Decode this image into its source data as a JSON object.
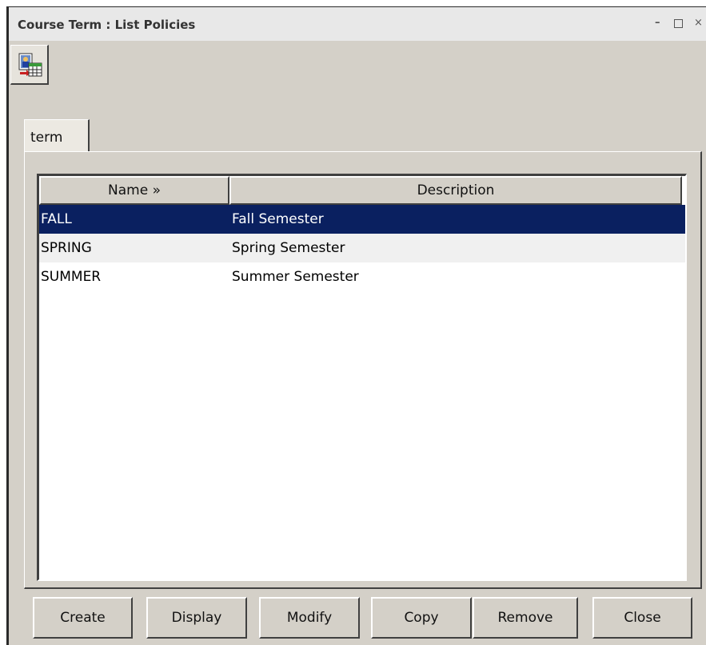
{
  "window": {
    "title": "Course Term : List Policies",
    "controls": {
      "minimize": "–",
      "maximize": "",
      "close": "×"
    }
  },
  "toolbar": {
    "icon": "report-table-icon"
  },
  "tabs": [
    {
      "label": "term",
      "selected": true
    }
  ],
  "table": {
    "columns": [
      {
        "label": "Name »",
        "sort": "ascending"
      },
      {
        "label": "Description"
      }
    ],
    "rows": [
      {
        "name": "FALL",
        "description": "Fall Semester",
        "selected": true
      },
      {
        "name": "SPRING",
        "description": "Spring Semester",
        "selected": false
      },
      {
        "name": "SUMMER",
        "description": "Summer Semester",
        "selected": false
      }
    ]
  },
  "buttons": {
    "create": "Create",
    "display": "Display",
    "modify": "Modify",
    "copy": "Copy",
    "remove": "Remove",
    "close": "Close"
  },
  "colors": {
    "selection": "#0a2060",
    "face": "#d4d0c8"
  }
}
